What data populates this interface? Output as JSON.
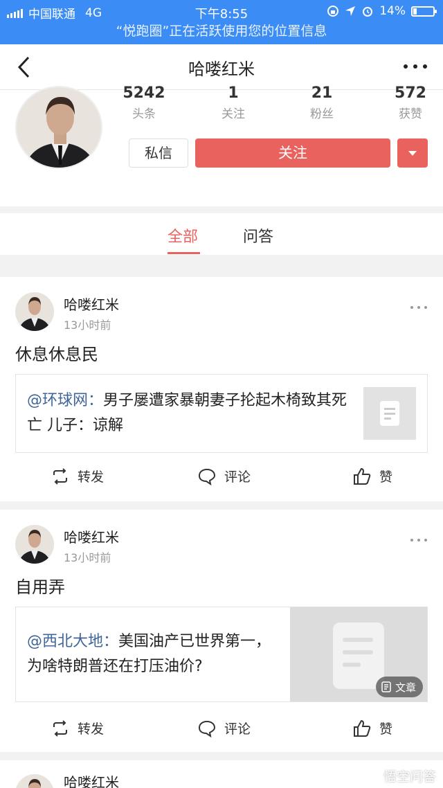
{
  "statusbar": {
    "carrier": "中国联通",
    "network": "4G",
    "time": "下午8:55",
    "battery": "14%"
  },
  "location_notice": "“悦跑圈”正在活跃使用您的位置信息",
  "nav": {
    "title": "哈喽红米"
  },
  "profile": {
    "stats": [
      {
        "value": "5242",
        "label": "头条"
      },
      {
        "value": "1",
        "label": "关注"
      },
      {
        "value": "21",
        "label": "粉丝"
      },
      {
        "value": "572",
        "label": "获赞"
      }
    ],
    "message_button": "私信",
    "follow_button": "关注"
  },
  "tabs": [
    {
      "label": "全部"
    },
    {
      "label": "问答"
    }
  ],
  "posts": [
    {
      "author": "哈喽红米",
      "time": "13小时前",
      "text": "休息休息民",
      "card": {
        "source": "@环球网：",
        "title": "男子屡遭家暴朝妻子抡起木椅致其死亡 儿子：谅解"
      }
    },
    {
      "author": "哈喽红米",
      "time": "13小时前",
      "text": "自用弄",
      "card": {
        "source": "@西北大地：",
        "title": "美国油产已世界第一，为啥特朗普还在打压油价?",
        "badge": "文章"
      }
    },
    {
      "author": "哈喽红米"
    }
  ],
  "actions": {
    "repost": "转发",
    "comment": "评论",
    "like": "赞"
  },
  "watermark": "悟空问答",
  "colors": {
    "accent": "#e9625d",
    "statusbar": "#3b8df5",
    "link": "#406599"
  }
}
